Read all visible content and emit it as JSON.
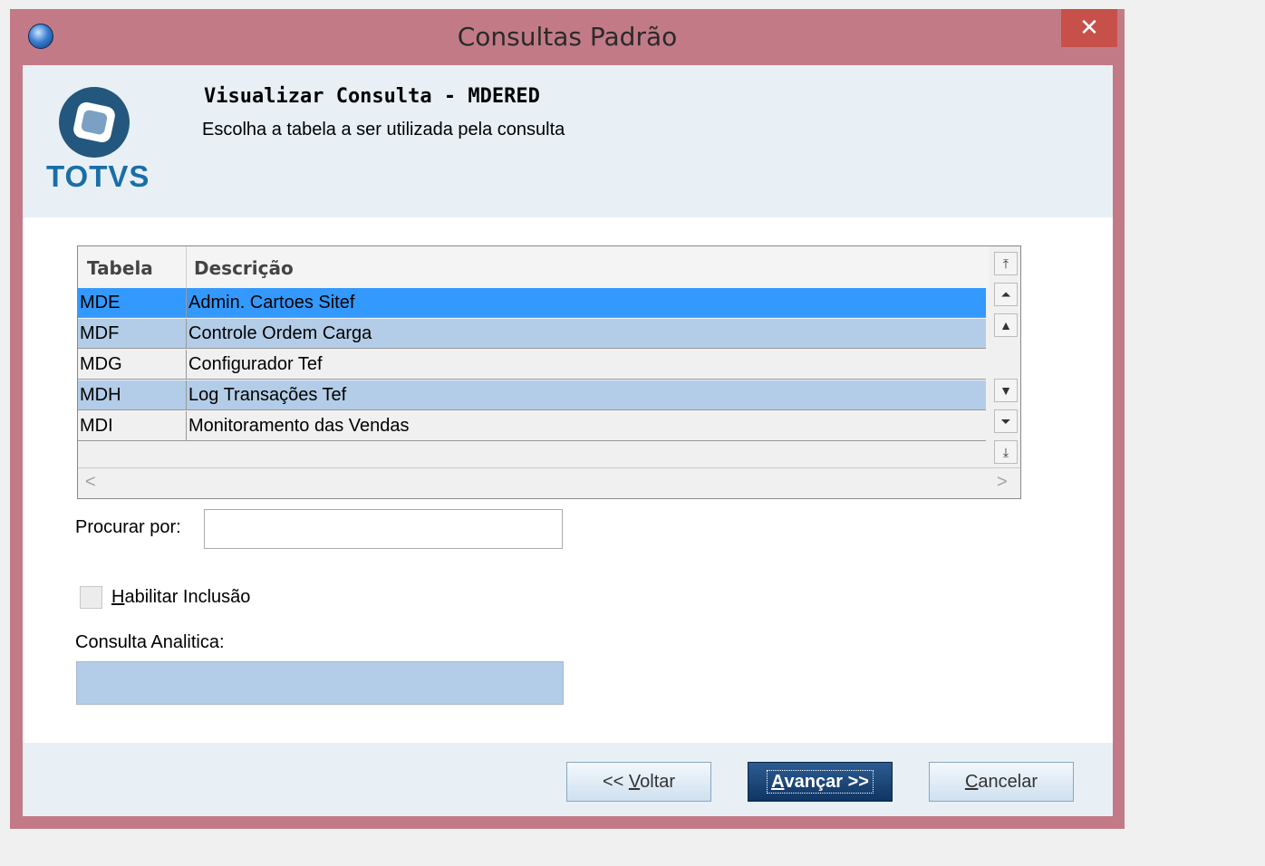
{
  "window": {
    "title": "Consultas Padrão",
    "close_label": "✕"
  },
  "header": {
    "logo_text": "TOTVS",
    "title": "Visualizar Consulta - MDERED",
    "subtitle": "Escolha a tabela a ser utilizada pela consulta"
  },
  "table": {
    "columns": [
      "Tabela",
      "Descrição"
    ],
    "rows": [
      {
        "code": "MDE",
        "desc": "Admin. Cartoes Sitef",
        "state": "selected"
      },
      {
        "code": "MDF",
        "desc": "Controle Ordem Carga",
        "state": "alt"
      },
      {
        "code": "MDG",
        "desc": "Configurador Tef",
        "state": "normal"
      },
      {
        "code": "MDH",
        "desc": "Log Transações Tef",
        "state": "alt"
      },
      {
        "code": "MDI",
        "desc": "Monitoramento das Vendas",
        "state": "normal"
      }
    ],
    "row_colors": {
      "selected": "#3399ff",
      "alt": "#b3cde8",
      "normal": "#f0f0f0"
    }
  },
  "search": {
    "label": "Procurar por:",
    "value": ""
  },
  "include_checkbox": {
    "label_prefix": "H",
    "label_rest": "abilitar Inclusão",
    "checked": false
  },
  "analytic": {
    "label": "Consulta Analitica:",
    "value": ""
  },
  "buttons": {
    "back_prefix": "<< ",
    "back_hotkey": "V",
    "back_rest": "oltar",
    "next_hotkey": "A",
    "next_rest": "vançar >>",
    "cancel_hotkey": "C",
    "cancel_rest": "ancelar"
  },
  "colors": {
    "window_frame": "#c27b86",
    "header_bg": "#e8f0f6",
    "accent": "#0f3563"
  }
}
